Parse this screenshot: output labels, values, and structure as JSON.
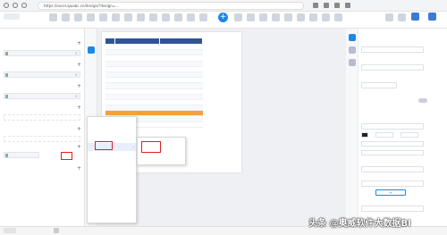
{
  "browser": {
    "url": "https://excel.qiuabc.cn/design/?design=...",
    "ctrl_icon": "Ctrl"
  },
  "left_panel": {
    "sections": [
      {
        "title": "",
        "field": ""
      },
      {
        "title": "",
        "field": ""
      },
      {
        "title": "",
        "field": ""
      },
      {
        "title": "",
        "field": ""
      },
      {
        "title": "",
        "field": ""
      },
      {
        "title": "",
        "field": ""
      }
    ]
  },
  "table": {
    "headers": [
      "",
      "",
      ""
    ],
    "rows": [
      [
        "",
        "",
        ""
      ],
      [
        "",
        "",
        ""
      ],
      [
        "",
        "",
        ""
      ],
      [
        "",
        "",
        ""
      ],
      [
        "",
        "",
        ""
      ],
      [
        "",
        "",
        ""
      ],
      [
        "",
        "",
        ""
      ],
      [
        "",
        "",
        ""
      ],
      [
        "",
        "",
        ""
      ],
      [
        "",
        "",
        ""
      ],
      [
        "",
        "",
        ""
      ],
      [
        "",
        "",
        ""
      ],
      [
        "",
        "",
        ""
      ],
      [
        "",
        "",
        ""
      ],
      [
        "",
        "",
        ""
      ]
    ],
    "total": ""
  },
  "context_menu": {
    "items": [
      "",
      "",
      "",
      "",
      "",
      "",
      "",
      "",
      "",
      "",
      "",
      "",
      "",
      ""
    ],
    "submenu": [
      "",
      ""
    ]
  },
  "right_panel": {
    "labels": [
      "",
      "",
      "",
      "",
      "",
      "",
      "",
      "",
      "",
      "",
      "",
      "",
      ""
    ]
  },
  "watermark": "头条 @奥威软件大数据BI",
  "colors": {
    "header_blue": "#2f5597",
    "highlight_orange": "#f4a13a",
    "accent_blue": "#1e88e5",
    "annotation_red": "#e02020"
  }
}
